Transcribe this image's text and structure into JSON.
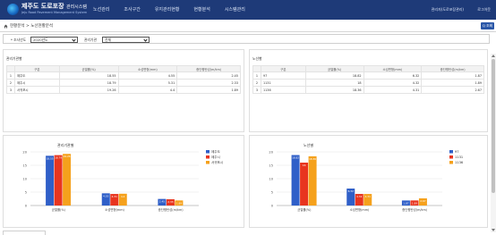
{
  "header": {
    "brand": "제주도 도로포장",
    "brand_suffix": "관리시스템",
    "brand_sub": "Jeju Road Pavement Management System",
    "nav": [
      "노선관리",
      "조사구간",
      "유지관리현황",
      "현황분석",
      "시스템관리"
    ],
    "user": "관리자(도로포장관리)",
    "logout": "로그아웃"
  },
  "breadcrumb": {
    "text": "현황분석 > 노선현황분석"
  },
  "search_button": "Q 조회",
  "filter": {
    "year_label": "* 조사년도",
    "year_value": "2020년도",
    "agency_label": "관리기관",
    "agency_value": "전체"
  },
  "agency_table": {
    "title": "관리기관별",
    "headers": [
      "",
      "구분",
      "균열률(%)",
      "소성변형(mm)",
      "종단평탄성(m/km)"
    ],
    "rows": [
      [
        "1",
        "제주도",
        "18.55",
        "4.55",
        "2.45"
      ],
      [
        "2",
        "제주시",
        "18.79",
        "5.31",
        "2.33"
      ],
      [
        "3",
        "서귀포시",
        "19.26",
        "4.4",
        "1.89"
      ]
    ]
  },
  "route_table": {
    "title": "노선별",
    "headers": [
      "",
      "구분",
      "균열률(%)",
      "소성변형(mm)",
      "종단평탄성(m/km)"
    ],
    "rows": [
      [
        "1",
        "97",
        "18.82",
        "6.32",
        "1.87"
      ],
      [
        "2",
        "1131",
        "18",
        "4.32",
        "1.89"
      ],
      [
        "3",
        "1136",
        "18.36",
        "4.31",
        "2.67"
      ]
    ]
  },
  "colors": {
    "header_bg": "#1e3a78",
    "series1": "#2f5fc8",
    "series2": "#e8351f",
    "series3": "#f5a11c"
  },
  "chart_data": [
    {
      "type": "bar",
      "title": "관리기관별",
      "categories": [
        "균열률(%)",
        "소성변형(mm)",
        "종단평탄성(m/km)"
      ],
      "series": [
        {
          "name": "제주도",
          "values": [
            18.55,
            4.55,
            2.45
          ]
        },
        {
          "name": "제주시",
          "values": [
            18.79,
            4.31,
            2.33
          ]
        },
        {
          "name": "서귀포시",
          "values": [
            19.26,
            4.4,
            1.89
          ]
        }
      ],
      "data_labels": [
        [
          "18.55",
          "4.55",
          "2.45"
        ],
        [
          "18.79",
          "4.31",
          "2.33"
        ],
        [
          "19.26",
          "4.4",
          "1.89"
        ]
      ],
      "ylim": [
        0,
        20
      ],
      "yticks": [
        "0",
        "5",
        "10",
        "15",
        "20"
      ],
      "grid": true,
      "legend": "right"
    },
    {
      "type": "bar",
      "title": "노선별",
      "categories": [
        "균열률(%)",
        "소성변형(mm)",
        "종단평탄성(m/km)"
      ],
      "series": [
        {
          "name": "97",
          "values": [
            18.82,
            6.32,
            1.87
          ]
        },
        {
          "name": "1131",
          "values": [
            16,
            4.32,
            1.89
          ]
        },
        {
          "name": "1136",
          "values": [
            18.36,
            4.31,
            2.67
          ]
        }
      ],
      "data_labels": [
        [
          "18.82",
          "6.32",
          "1.87"
        ],
        [
          "16",
          "4.32",
          "1.89"
        ],
        [
          "18.36",
          "4.31",
          "2.67"
        ]
      ],
      "ylim": [
        0,
        20
      ],
      "yticks": [
        "0",
        "5",
        "10",
        "15",
        "20"
      ],
      "grid": true,
      "legend": "right"
    }
  ]
}
